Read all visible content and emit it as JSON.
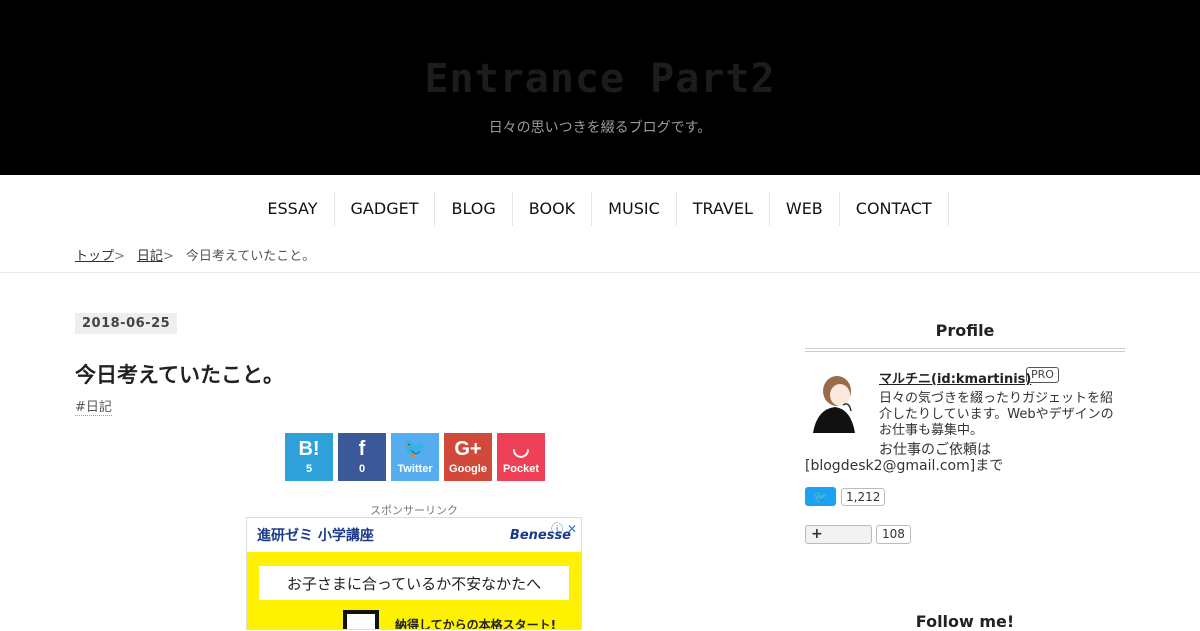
{
  "header": {
    "site_title": "Entrance Part2",
    "site_description": "日々の思いつきを綴るブログです。"
  },
  "nav": {
    "items": [
      "ESSAY",
      "GADGET",
      "BLOG",
      "BOOK",
      "MUSIC",
      "TRAVEL",
      "WEB",
      "CONTACT"
    ]
  },
  "breadcrumb": {
    "items": [
      "トップ",
      "日記",
      "今日考えていたこと。"
    ],
    "separator": ">"
  },
  "entry": {
    "date": "2018-06-25",
    "title": "今日考えていたこと。",
    "category": "#日記"
  },
  "share": {
    "hatena": {
      "glyph": "B!",
      "count": "5"
    },
    "facebook": {
      "glyph": "f",
      "count": "0"
    },
    "twitter": {
      "glyph": "🐦",
      "label": "Twitter"
    },
    "google": {
      "glyph": "G+",
      "label": "Google"
    },
    "pocket": {
      "glyph": "◡",
      "label": "Pocket"
    }
  },
  "ad": {
    "label": "スポンサーリンク",
    "brand_left": "進研ゼミ 小学講座",
    "brand_right": "Benesse",
    "close": "ⓘ ✕",
    "bubble_text": "お子さまに合っているか不安なかたへ",
    "bottom_text": "納得してからの本格スタート!"
  },
  "sidebar": {
    "profile_title": "Profile",
    "profile_name": "マルチニ(id:kmartinis)",
    "pro_badge": "PRO",
    "profile_description": "日々の気づきを綴ったりガジェットを紹介したりしています。Webやデザインのお仕事も募集中。",
    "profile_contact": "お仕事のご依頼は",
    "profile_email": "[blogdesk2@gmail.com]まで",
    "twitter_follow_icon": "🐦",
    "twitter_count": "1,212",
    "hatena_follow_icon": "+",
    "hatena_count": "108",
    "follow_title": "Follow me!"
  }
}
